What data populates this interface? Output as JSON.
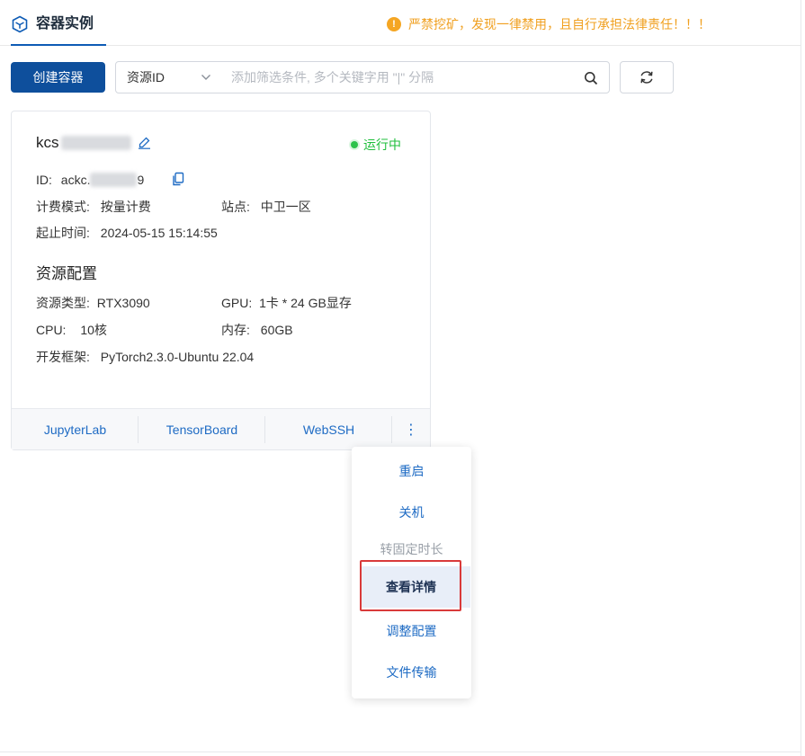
{
  "tabs": {
    "active_label": "容器实例"
  },
  "warning": {
    "icon": "!",
    "text": "严禁挖矿，发现一律禁用，且自行承担法律责任！！！",
    "color": "#f0a020"
  },
  "toolbar": {
    "create_label": "创建容器",
    "filter_type": "资源ID",
    "search_placeholder": "添加筛选条件, 多个关键字用 \"|\" 分隔"
  },
  "instance": {
    "name_prefix": "kcs",
    "status": "运行中",
    "status_color": "#1fbf3c",
    "id_label": "ID:",
    "id_prefix": "ackc.",
    "id_suffix": "9",
    "billing_label": "计费模式:",
    "billing_value": "按量计费",
    "site_label": "站点:",
    "site_value": "中卫一区",
    "time_label": "起止时间:",
    "time_value": "2024-05-15 15:14:55",
    "section_title": "资源配置",
    "res_type_label": "资源类型:",
    "res_type_value": "RTX3090",
    "gpu_label": "GPU:",
    "gpu_value": "1卡 * 24 GB显存",
    "cpu_label": "CPU:",
    "cpu_value": "10核",
    "mem_label": "内存:",
    "mem_value": "60GB",
    "framework_label": "开发框架:",
    "framework_value": "PyTorch2.3.0-Ubuntu 22.04"
  },
  "footer_actions": [
    "JupyterLab",
    "TensorBoard",
    "WebSSH"
  ],
  "more_label": "⋮",
  "menu": {
    "restart": "重启",
    "shutdown": "关机",
    "fixed_duration": "转固定时长",
    "view_details": "查看详情",
    "adjust_config": "调整配置",
    "file_transfer": "文件传输"
  },
  "colors": {
    "primary": "#0e4f9c",
    "link": "#1e6bc4",
    "highlight": "#d93a3a"
  }
}
